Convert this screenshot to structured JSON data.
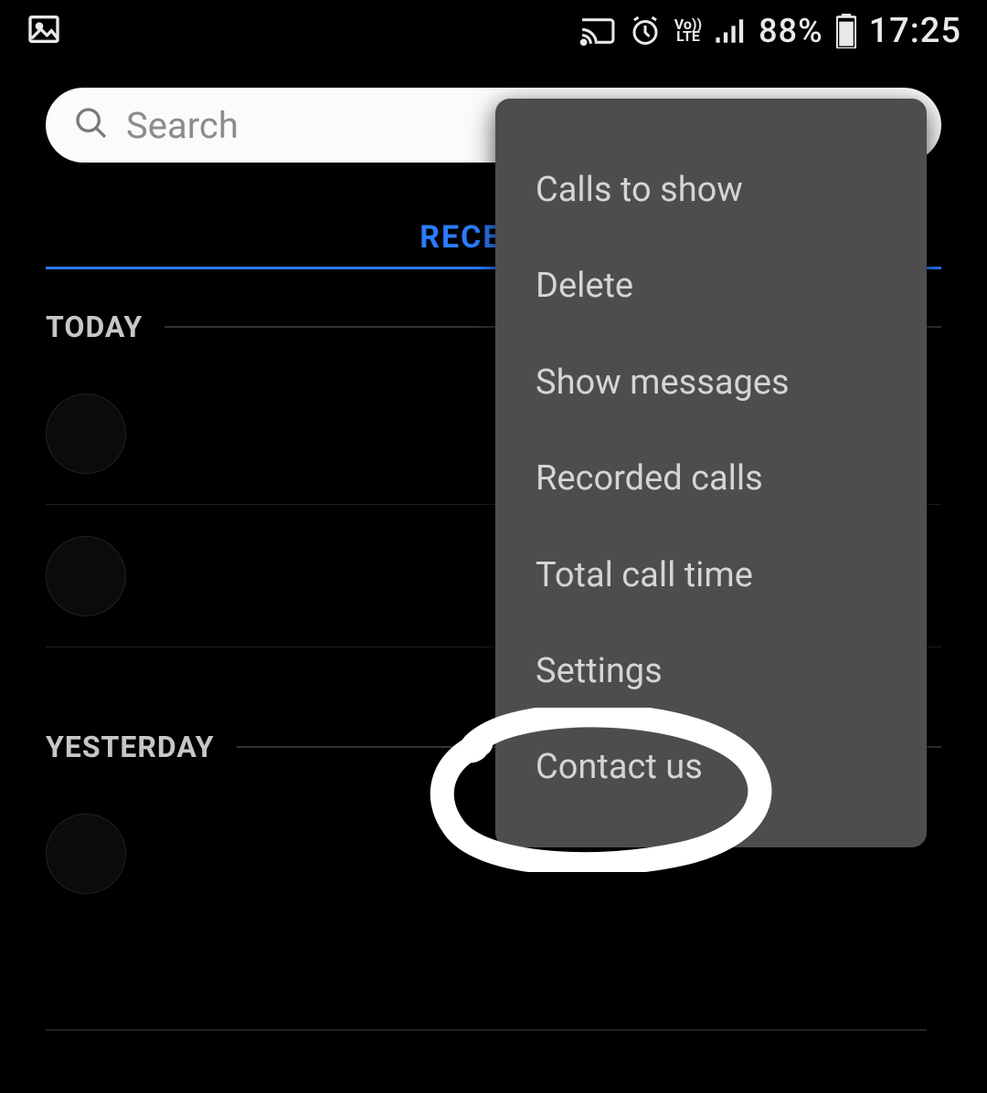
{
  "status": {
    "battery": "88%",
    "time": "17:25",
    "volte": "Vo))",
    "volte2": "LTE"
  },
  "search": {
    "placeholder": "Search"
  },
  "tabs": {
    "recents": "RECENTS"
  },
  "sections": {
    "today": "TODAY",
    "yesterday": "YESTERDAY"
  },
  "menu": {
    "calls_to_show": "Calls to show",
    "delete": "Delete",
    "show_messages": "Show messages",
    "recorded_calls": "Recorded calls",
    "total_call_time": "Total call time",
    "settings": "Settings",
    "contact_us": "Contact us"
  }
}
